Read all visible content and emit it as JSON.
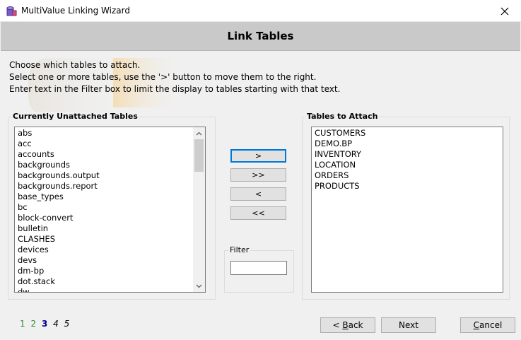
{
  "window": {
    "title": "MultiValue Linking Wizard",
    "app_icon": "db-wizard-icon",
    "close_icon": "close-icon"
  },
  "header": {
    "title": "Link Tables"
  },
  "instructions": [
    "Choose which tables to attach.",
    "Select one or more tables, use the '>' button to move them to the right.",
    "Enter text in the Filter box to limit the display to tables starting with that text."
  ],
  "unattached": {
    "label": "Currently Unattached Tables",
    "items": [
      "abs",
      "acc",
      "accounts",
      "backgrounds",
      "backgrounds.output",
      "backgrounds.report",
      "base_types",
      "bc",
      "block-convert",
      "bulletin",
      "CLASHES",
      "devices",
      "devs",
      "dm-bp",
      "dot.stack",
      "dw"
    ]
  },
  "attach": {
    "label": "Tables to Attach",
    "items": [
      "CUSTOMERS",
      "DEMO.BP",
      "INVENTORY",
      "LOCATION",
      "ORDERS",
      "PRODUCTS"
    ]
  },
  "move_buttons": {
    "add": ">",
    "add_all": ">>",
    "remove": "<",
    "remove_all": "<<"
  },
  "filter": {
    "label": "Filter",
    "value": ""
  },
  "steps": [
    {
      "num": "1",
      "state": "done"
    },
    {
      "num": "2",
      "state": "done"
    },
    {
      "num": "3",
      "state": "current"
    },
    {
      "num": "4",
      "state": "future"
    },
    {
      "num": "5",
      "state": "future"
    }
  ],
  "footer": {
    "back_prefix": "< ",
    "back_key": "B",
    "back_rest": "ack",
    "next": "Next",
    "cancel_key": "C",
    "cancel_rest": "ancel"
  },
  "colors": {
    "header_band": "#c9c9c9",
    "focus_border": "#0078d7",
    "step_done": "#2e8b2e",
    "step_current": "#00008b"
  }
}
